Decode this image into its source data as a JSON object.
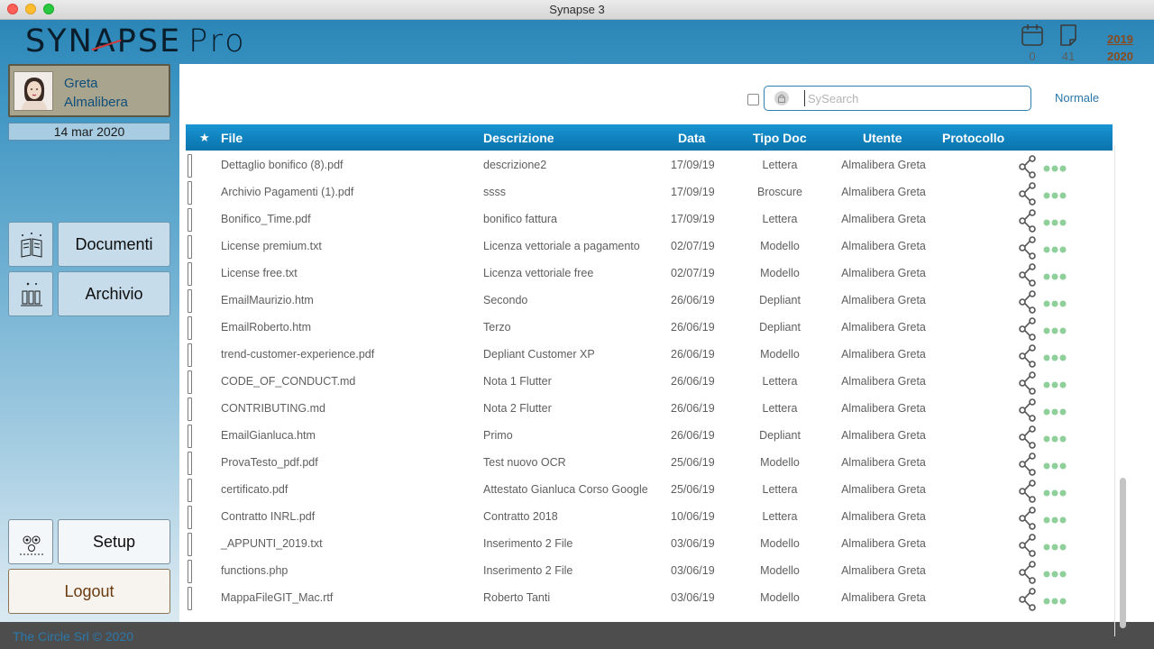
{
  "window": {
    "title": "Synapse 3"
  },
  "brand": {
    "name": "SYNAPSE",
    "edition": "Pro"
  },
  "header": {
    "calendar_count": "0",
    "docs_count": "41",
    "years": [
      "2019",
      "2020"
    ]
  },
  "user": {
    "first_name": "Greta",
    "last_name": "Almalibera",
    "date": "14 mar 2020"
  },
  "nav": {
    "documents": "Documenti",
    "archive": "Archivio",
    "setup": "Setup",
    "logout": "Logout"
  },
  "search": {
    "placeholder": "SySearch",
    "value": "",
    "mode": "Normale"
  },
  "table": {
    "star": "★",
    "headers": {
      "file": "File",
      "description": "Descrizione",
      "date": "Data",
      "type": "Tipo Doc",
      "user": "Utente",
      "protocol": "Protocollo"
    },
    "rows": [
      {
        "file": "Dettaglio bonifico (8).pdf",
        "description": "descrizione2",
        "date": "17/09/19",
        "type": "Lettera",
        "user": "Almalibera Greta"
      },
      {
        "file": "Archivio Pagamenti (1).pdf",
        "description": "ssss",
        "date": "17/09/19",
        "type": "Broscure",
        "user": "Almalibera Greta"
      },
      {
        "file": "Bonifico_Time.pdf",
        "description": "bonifico fattura",
        "date": "17/09/19",
        "type": "Lettera",
        "user": "Almalibera Greta"
      },
      {
        "file": "License premium.txt",
        "description": "Licenza vettoriale a pagamento",
        "date": "02/07/19",
        "type": "Modello",
        "user": "Almalibera Greta"
      },
      {
        "file": "License free.txt",
        "description": "Licenza vettoriale free",
        "date": "02/07/19",
        "type": "Modello",
        "user": "Almalibera Greta"
      },
      {
        "file": "EmailMaurizio.htm",
        "description": "Secondo",
        "date": "26/06/19",
        "type": "Depliant",
        "user": "Almalibera Greta"
      },
      {
        "file": "EmailRoberto.htm",
        "description": "Terzo",
        "date": "26/06/19",
        "type": "Depliant",
        "user": "Almalibera Greta"
      },
      {
        "file": "trend-customer-experience.pdf",
        "description": "Depliant Customer XP",
        "date": "26/06/19",
        "type": "Modello",
        "user": "Almalibera Greta"
      },
      {
        "file": "CODE_OF_CONDUCT.md",
        "description": "Nota 1 Flutter",
        "date": "26/06/19",
        "type": "Lettera",
        "user": "Almalibera Greta"
      },
      {
        "file": "CONTRIBUTING.md",
        "description": "Nota 2 Flutter",
        "date": "26/06/19",
        "type": "Lettera",
        "user": "Almalibera Greta"
      },
      {
        "file": "EmailGianluca.htm",
        "description": "Primo",
        "date": "26/06/19",
        "type": "Depliant",
        "user": "Almalibera Greta"
      },
      {
        "file": "ProvaTesto_pdf.pdf",
        "description": "Test nuovo OCR",
        "date": "25/06/19",
        "type": "Modello",
        "user": "Almalibera Greta"
      },
      {
        "file": "certificato.pdf",
        "description": "Attestato Gianluca Corso Google",
        "date": "25/06/19",
        "type": "Lettera",
        "user": "Almalibera Greta"
      },
      {
        "file": "Contratto INRL.pdf",
        "description": "Contratto 2018",
        "date": "10/06/19",
        "type": "Lettera",
        "user": "Almalibera Greta"
      },
      {
        "file": "_APPUNTI_2019.txt",
        "description": "Inserimento 2 File",
        "date": "03/06/19",
        "type": "Modello",
        "user": "Almalibera Greta"
      },
      {
        "file": "functions.php",
        "description": "Inserimento 2 File",
        "date": "03/06/19",
        "type": "Modello",
        "user": "Almalibera Greta"
      },
      {
        "file": "MappaFileGIT_Mac.rtf",
        "description": "Roberto Tanti",
        "date": "03/06/19",
        "type": "Modello",
        "user": "Almalibera Greta"
      }
    ]
  },
  "footer": {
    "copyright": "The Circle Srl © 2020"
  },
  "colors": {
    "header_blue": "#0f80bc",
    "sidebar_blue": "#2b86b7",
    "accent_link": "#2a77aa",
    "year_brown": "#8a4a1e",
    "dots_green": "#8fcf9a"
  },
  "icons": {
    "row_share": "share-icon",
    "row_more": "more-dots-icon",
    "calendar": "calendar-icon",
    "document": "document-icon",
    "lock": "lock-icon"
  }
}
